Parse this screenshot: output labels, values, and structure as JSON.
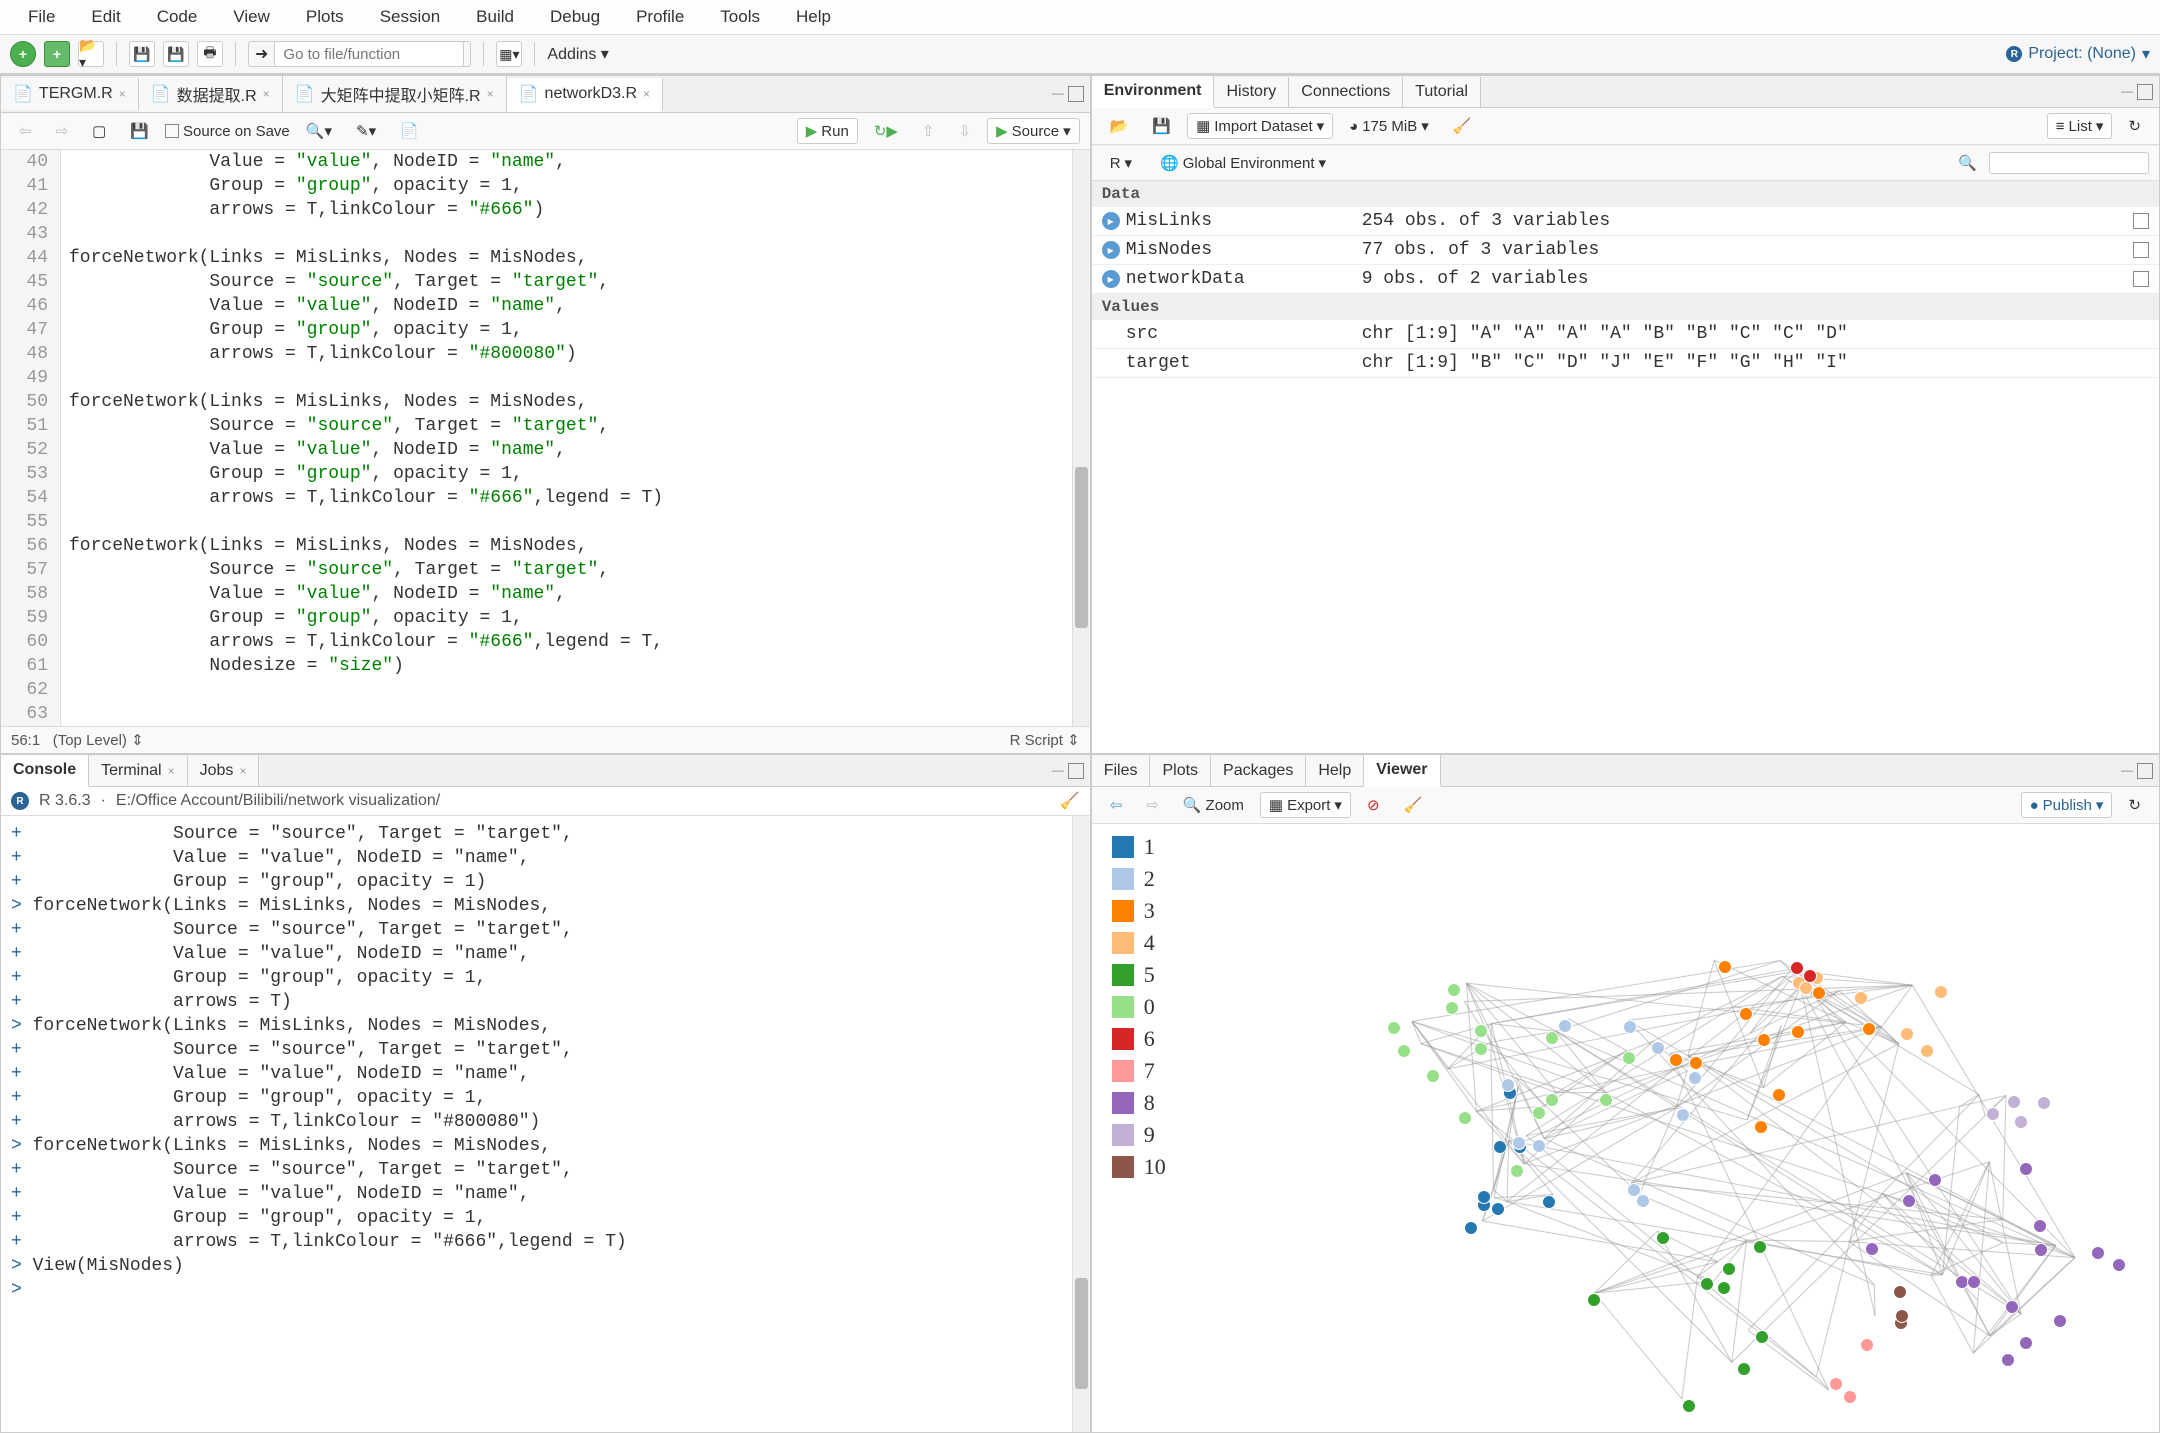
{
  "menubar": [
    "File",
    "Edit",
    "Code",
    "View",
    "Plots",
    "Session",
    "Build",
    "Debug",
    "Profile",
    "Tools",
    "Help"
  ],
  "top_toolbar": {
    "goto_placeholder": "Go to file/function",
    "addins": "Addins",
    "project": "Project: (None)"
  },
  "source": {
    "tabs": [
      {
        "label": "TERGM.R",
        "active": false
      },
      {
        "label": "数据提取.R",
        "active": false
      },
      {
        "label": "大矩阵中提取小矩阵.R",
        "active": false
      },
      {
        "label": "networkD3.R",
        "active": true
      }
    ],
    "toolbar": {
      "source_on_save": "Source on Save",
      "run": "Run",
      "source_btn": "Source"
    },
    "lines_start": 40,
    "lines": [
      "             Value = \"value\", NodeID = \"name\",",
      "             Group = \"group\", opacity = 1,",
      "             arrows = T,linkColour = \"#666\")",
      "",
      "forceNetwork(Links = MisLinks, Nodes = MisNodes,",
      "             Source = \"source\", Target = \"target\",",
      "             Value = \"value\", NodeID = \"name\",",
      "             Group = \"group\", opacity = 1,",
      "             arrows = T,linkColour = \"#800080\")",
      "",
      "forceNetwork(Links = MisLinks, Nodes = MisNodes,",
      "             Source = \"source\", Target = \"target\",",
      "             Value = \"value\", NodeID = \"name\",",
      "             Group = \"group\", opacity = 1,",
      "             arrows = T,linkColour = \"#666\",legend = T)",
      "",
      "forceNetwork(Links = MisLinks, Nodes = MisNodes,",
      "             Source = \"source\", Target = \"target\",",
      "             Value = \"value\", NodeID = \"name\",",
      "             Group = \"group\", opacity = 1,",
      "             arrows = T,linkColour = \"#666\",legend = T,",
      "             Nodesize = \"size\")",
      "",
      ""
    ],
    "status_left": "56:1",
    "status_scope": "(Top Level)",
    "status_right": "R Script"
  },
  "console": {
    "tabs": [
      "Console",
      "Terminal",
      "Jobs"
    ],
    "header_ver": "R 3.6.3",
    "header_path": "E:/Office Account/Bilibili/network visualization/",
    "lines": [
      "+              Source = \"source\", Target = \"target\",",
      "+              Value = \"value\", NodeID = \"name\",",
      "+              Group = \"group\", opacity = 1)",
      "> forceNetwork(Links = MisLinks, Nodes = MisNodes,",
      "+              Source = \"source\", Target = \"target\",",
      "+              Value = \"value\", NodeID = \"name\",",
      "+              Group = \"group\", opacity = 1,",
      "+              arrows = T)",
      "> forceNetwork(Links = MisLinks, Nodes = MisNodes,",
      "+              Source = \"source\", Target = \"target\",",
      "+              Value = \"value\", NodeID = \"name\",",
      "+              Group = \"group\", opacity = 1,",
      "+              arrows = T,linkColour = \"#800080\")",
      "> forceNetwork(Links = MisLinks, Nodes = MisNodes,",
      "+              Source = \"source\", Target = \"target\",",
      "+              Value = \"value\", NodeID = \"name\",",
      "+              Group = \"group\", opacity = 1,",
      "+              arrows = T,linkColour = \"#666\",legend = T)",
      "> View(MisNodes)",
      "> "
    ]
  },
  "env": {
    "tabs": [
      "Environment",
      "History",
      "Connections",
      "Tutorial"
    ],
    "toolbar": {
      "import": "Import Dataset",
      "mem": "175 MiB",
      "list": "List"
    },
    "scope_r": "R",
    "scope_env": "Global Environment",
    "data_hdr": "Data",
    "values_hdr": "Values",
    "data_items": [
      {
        "name": "MisLinks",
        "desc": "254 obs. of 3 variables"
      },
      {
        "name": "MisNodes",
        "desc": "77 obs. of 3 variables"
      },
      {
        "name": "networkData",
        "desc": "9 obs. of 2 variables"
      }
    ],
    "value_items": [
      {
        "name": "src",
        "desc": "chr [1:9] \"A\" \"A\" \"A\" \"A\" \"B\" \"B\" \"C\" \"C\" \"D\""
      },
      {
        "name": "target",
        "desc": "chr [1:9] \"B\" \"C\" \"D\" \"J\" \"E\" \"F\" \"G\" \"H\" \"I\""
      }
    ]
  },
  "viewer": {
    "tabs": [
      "Files",
      "Plots",
      "Packages",
      "Help",
      "Viewer"
    ],
    "toolbar": {
      "zoom": "Zoom",
      "export": "Export",
      "publish": "Publish"
    },
    "legend": [
      {
        "label": "1",
        "color": "#2678b2"
      },
      {
        "label": "2",
        "color": "#afc8e7"
      },
      {
        "label": "3",
        "color": "#fd8002"
      },
      {
        "label": "4",
        "color": "#ffbb78"
      },
      {
        "label": "5",
        "color": "#33a02c"
      },
      {
        "label": "0",
        "color": "#98df8a"
      },
      {
        "label": "6",
        "color": "#d62728"
      },
      {
        "label": "7",
        "color": "#ff9896"
      },
      {
        "label": "8",
        "color": "#9467bd"
      },
      {
        "label": "9",
        "color": "#c3b0d5"
      },
      {
        "label": "10",
        "color": "#8c564b"
      }
    ]
  },
  "chart_data": {
    "type": "network",
    "title": "forceNetwork (networkD3) — Les Misérables co-occurrence",
    "nodes_count": 77,
    "links_count": 254,
    "groups": [
      0,
      1,
      2,
      3,
      4,
      5,
      6,
      7,
      8,
      9,
      10
    ],
    "group_colors": {
      "1": "#2678b2",
      "2": "#afc8e7",
      "3": "#fd8002",
      "4": "#ffbb78",
      "5": "#33a02c",
      "0": "#98df8a",
      "6": "#d62728",
      "7": "#ff9896",
      "8": "#9467bd",
      "9": "#c3b0d5",
      "10": "#8c564b"
    },
    "arrows": true,
    "linkColour": "#666",
    "legend": true
  }
}
